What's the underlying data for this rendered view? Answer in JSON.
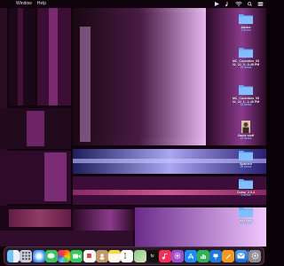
{
  "menubar": {
    "items": [
      "Window",
      "Help"
    ]
  },
  "desktop_icons": [
    {
      "name": "Adobe",
      "sub": "3 items",
      "kind": "folder"
    },
    {
      "name": "MC_Countries_05",
      "name2": "02_22_0...0-49 PM",
      "sub": "15 items",
      "kind": "folder"
    },
    {
      "name": "MC_Countries_05",
      "name2": "02_22_1...1-40 PM",
      "sub": "14 items",
      "kind": "folder"
    },
    {
      "name": "Game stuff",
      "sub": "15 items",
      "kind": "folder-image"
    },
    {
      "name": "Spanish",
      "sub": "26 items",
      "kind": "folder"
    },
    {
      "name": "Cumu_2.0-4",
      "sub": "3 items",
      "kind": "folder"
    },
    {
      "name": "last stuff",
      "sub": "14 items",
      "kind": "folder"
    }
  ],
  "dock_apps": [
    "finder-icon",
    "launchpad-icon",
    "safari-icon",
    "messages-icon",
    "photos-icon",
    "facetime-icon",
    "calendar-icon",
    "contacts-icon",
    "notes-icon",
    "reminders-icon",
    "maps-icon",
    "apple-tv-icon",
    "music-icon",
    "podcasts-icon",
    "appstore-icon",
    "numbers-icon",
    "keynote-icon",
    "pages-icon",
    "mail-icon",
    "system-settings-icon"
  ],
  "dock_app_labels": {
    "appletv": "tv"
  },
  "colors": {
    "folder": "#5aaaf4",
    "accent_pink": "#d36bd0",
    "menubar": "#150a10"
  }
}
